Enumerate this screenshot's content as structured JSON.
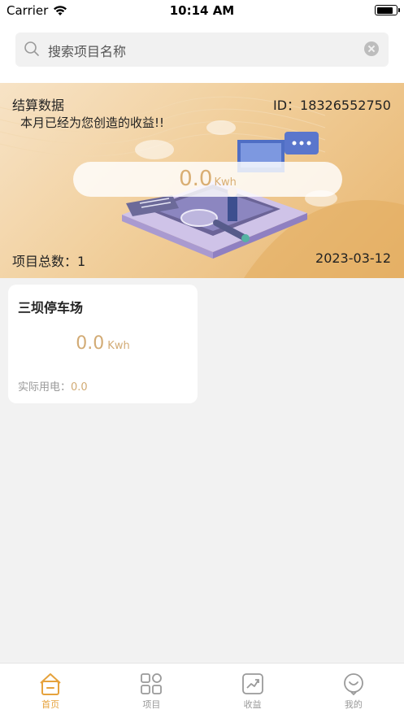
{
  "status_bar": {
    "carrier": "Carrier",
    "time": "10:14 AM",
    "battery_level": 0.9
  },
  "search": {
    "placeholder": "搜索项目名称"
  },
  "banner": {
    "title": "结算数据",
    "id_text": "ID：18326552750",
    "subtitle": "本月已经为您创造的收益!!",
    "energy_value": "0.0",
    "energy_unit": "Kwh",
    "project_count_text": "项目总数：1",
    "date": "2023-03-12"
  },
  "projects": [
    {
      "name": "三坝停车场",
      "energy_value": "0.0",
      "energy_unit": "Kwh",
      "actual_label": "实际用电：",
      "actual_value": "0.0"
    }
  ],
  "tab_bar": {
    "tabs": [
      {
        "label": "首页",
        "icon": "home-icon",
        "active": true
      },
      {
        "label": "项目",
        "icon": "grid-icon",
        "active": false
      },
      {
        "label": "收益",
        "icon": "chart-icon",
        "active": false
      },
      {
        "label": "我的",
        "icon": "profile-icon",
        "active": false
      }
    ]
  },
  "colors": {
    "accent": "#e6a23c",
    "value_gold": "#d9ae73",
    "banner_start": "#f7e3c6",
    "banner_end": "#e8b670"
  }
}
